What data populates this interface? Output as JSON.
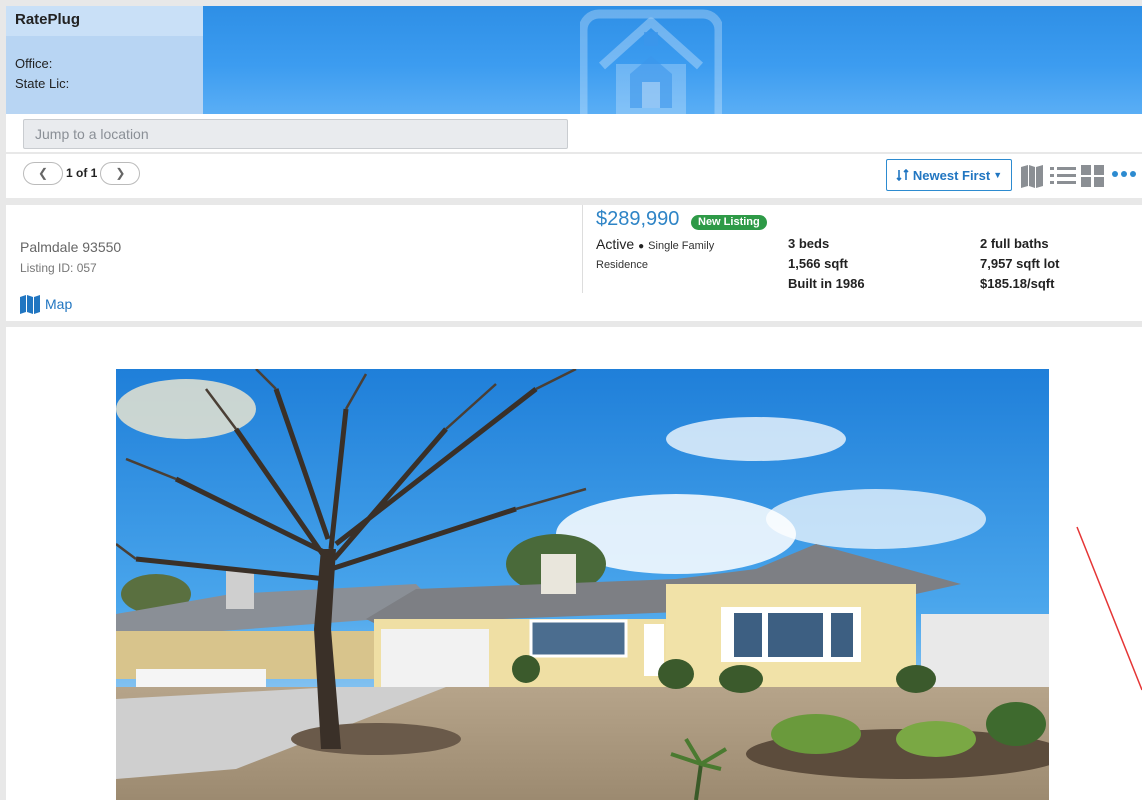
{
  "header": {
    "brand": "RatePlug",
    "office_label": "Office:",
    "license_label": "State Lic:"
  },
  "search": {
    "placeholder": "Jump to a location"
  },
  "toolbar": {
    "prev_icon": "chevron-left-icon",
    "page_text": "1 of 1",
    "next_icon": "chevron-right-icon",
    "sort_label": "Newest First",
    "view_icons": [
      "map-view-icon",
      "list-view-icon",
      "grid-view-icon",
      "more-icon"
    ],
    "accent_color": "#2176c1"
  },
  "listing": {
    "city": "Palmdale 93550",
    "listing_id": "Listing ID: 057",
    "map_label": "Map",
    "price": "$289,990",
    "badge": "New Listing",
    "status": "Active",
    "property_type_1": "Single Family",
    "property_type_2": "Residence",
    "facts": {
      "beds": "3 beds",
      "baths": "2 full baths",
      "sqft": "1,566 sqft",
      "lot": "7,957 sqft lot",
      "built": "Built in 1986",
      "price_per_sqft": "$185.18/sqft"
    },
    "badge_color": "#2e9a47",
    "price_color": "#2e84c6"
  },
  "photo": {
    "subject": "house-photo"
  }
}
